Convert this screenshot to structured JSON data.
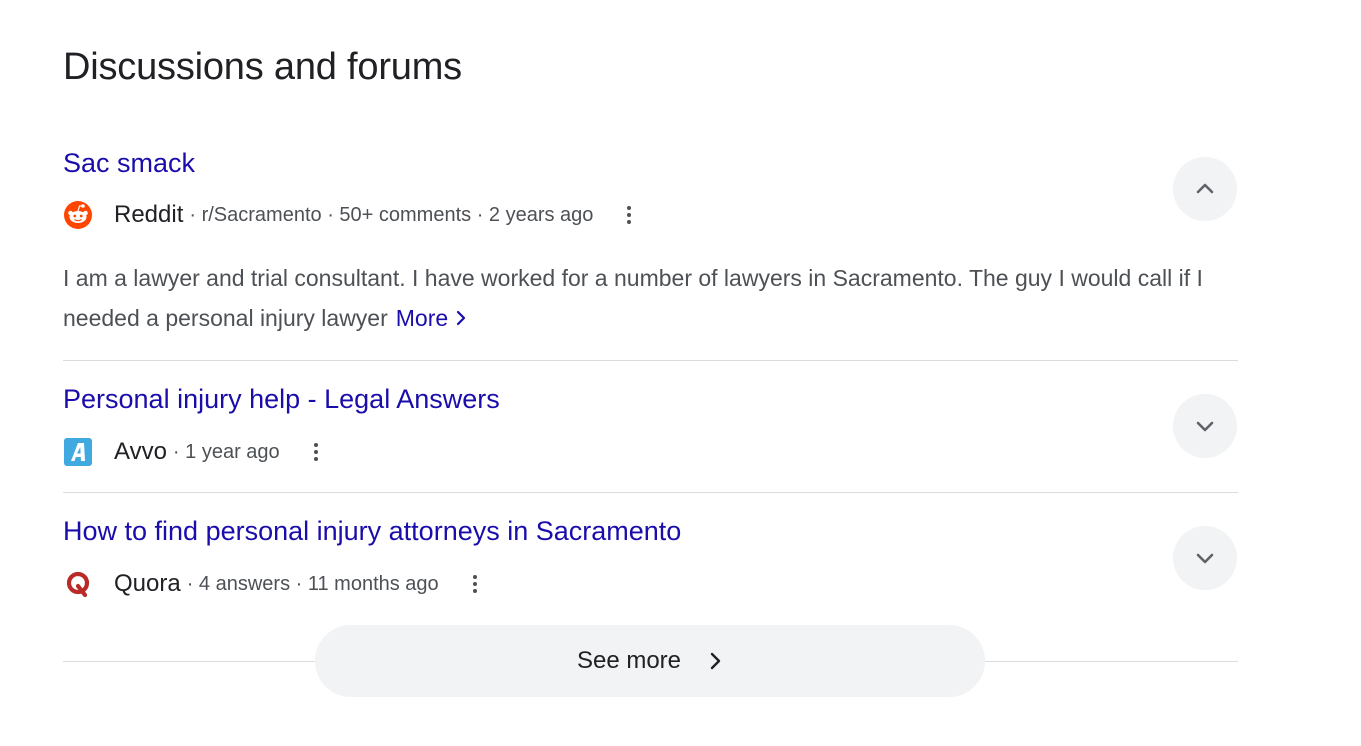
{
  "heading": "Discussions and forums",
  "items": [
    {
      "title": "Sac smack",
      "source": "Reddit",
      "detail": "· r/Sacramento · 50+ comments · 2 years ago",
      "snippet": "I am a lawyer and trial consultant. I have worked for a number of lawyers in Sacramento. The guy I would call if I needed a personal injury lawyer",
      "more_label": "More",
      "logo_icon": "reddit-logo-icon",
      "expanded": true
    },
    {
      "title": "Personal injury help - Legal Answers",
      "source": "Avvo",
      "detail": "· 1 year ago",
      "logo_icon": "avvo-logo-icon",
      "expanded": false
    },
    {
      "title": "How to find personal injury attorneys in Sacramento",
      "source": "Quora",
      "detail": "· 4 answers · 11 months ago",
      "logo_icon": "quora-logo-icon",
      "expanded": false
    }
  ],
  "see_more_label": "See more",
  "colors": {
    "link": "#1a0dab",
    "text": "#202124",
    "secondary": "#4d5156",
    "button_bg": "#f1f3f4",
    "divider": "#dadce0",
    "reddit": "#ff4500",
    "avvo": "#3fa9e0",
    "quora": "#b92b27"
  }
}
